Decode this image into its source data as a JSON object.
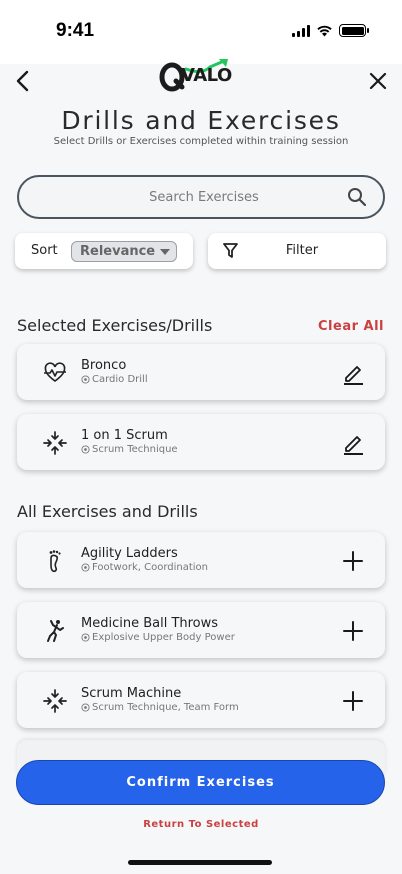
{
  "status_bar": {
    "time": "9:41"
  },
  "logo": {
    "text": "VALO"
  },
  "header": {
    "title": "Drills and Exercises",
    "subtitle": "Select Drills or Exercises completed within training session"
  },
  "search": {
    "placeholder": "Search Exercises",
    "value": ""
  },
  "sort": {
    "label": "Sort",
    "selected": "Relevance"
  },
  "filter": {
    "label": "Filter"
  },
  "selected_section": {
    "title": "Selected Exercises/Drills",
    "clear_label": "Clear All",
    "items": [
      {
        "name": "Bronco",
        "category": "Cardio Drill",
        "icon": "heartbeat-icon"
      },
      {
        "name": "1 on 1 Scrum",
        "category": "Scrum Technique",
        "icon": "converge-arrows-icon"
      }
    ]
  },
  "all_section": {
    "title": "All Exercises and Drills",
    "items": [
      {
        "name": "Agility Ladders",
        "category": "Footwork, Coordination",
        "icon": "footprint-icon"
      },
      {
        "name": "Medicine Ball Throws",
        "category": "Explosive Upper Body Power",
        "icon": "throw-icon"
      },
      {
        "name": "Scrum Machine",
        "category": "Scrum Technique, Team Form",
        "icon": "converge-arrows-icon"
      }
    ]
  },
  "confirm_button": {
    "label": "Confirm Exercises"
  },
  "return_link": {
    "label": "Return To Selected"
  },
  "colors": {
    "accent": "#2563eb",
    "danger": "#c94141",
    "logo_arrow": "#22c55e"
  }
}
